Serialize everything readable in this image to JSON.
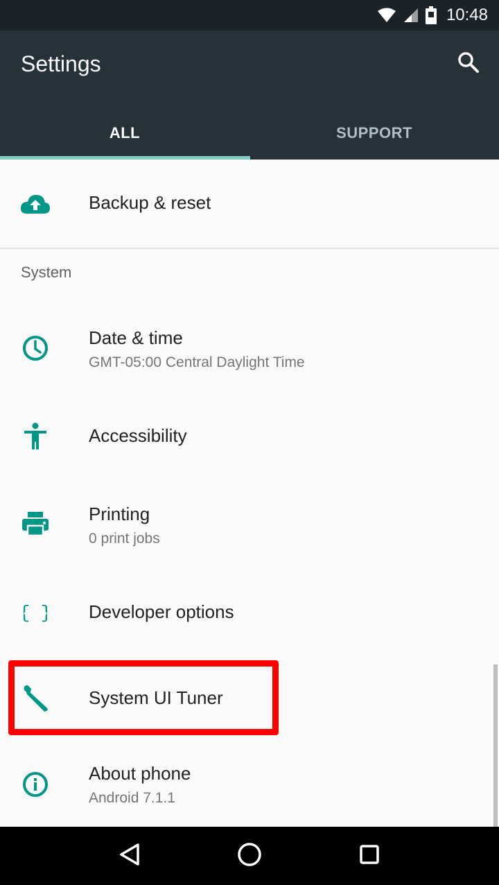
{
  "status_bar": {
    "time": "10:48"
  },
  "app_bar": {
    "title": "Settings"
  },
  "tabs": [
    {
      "label": "ALL",
      "selected": true
    },
    {
      "label": "SUPPORT",
      "selected": false
    }
  ],
  "accent_color": "#009688",
  "items": {
    "backup": {
      "title": "Backup & reset",
      "icon": "cloud-upload-icon"
    },
    "system_header": "System",
    "date_time": {
      "title": "Date & time",
      "subtitle": "GMT-05:00 Central Daylight Time",
      "icon": "clock-icon"
    },
    "accessibility": {
      "title": "Accessibility",
      "icon": "accessibility-icon"
    },
    "printing": {
      "title": "Printing",
      "subtitle": "0 print jobs",
      "icon": "printer-icon"
    },
    "developer": {
      "title": "Developer options",
      "icon": "braces-icon"
    },
    "tuner": {
      "title": "System UI Tuner",
      "icon": "wrench-icon"
    },
    "about": {
      "title": "About phone",
      "subtitle": "Android 7.1.1",
      "icon": "info-icon"
    }
  }
}
